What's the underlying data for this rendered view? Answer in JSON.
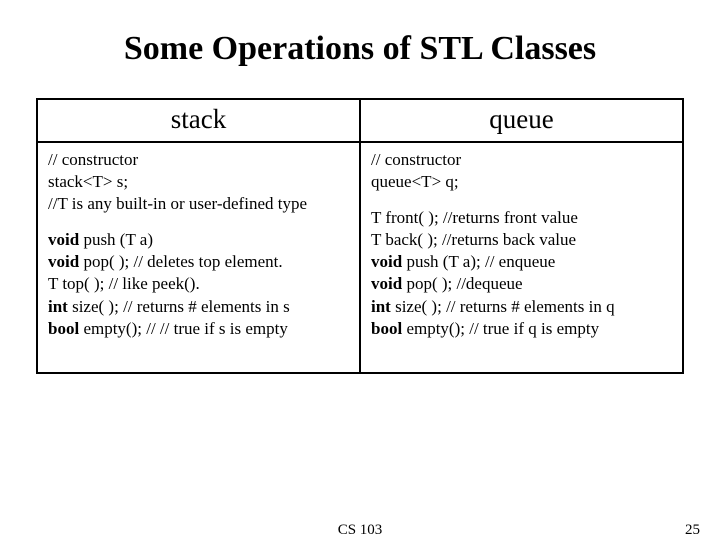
{
  "title": "Some Operations of STL Classes",
  "table": {
    "headers": {
      "left": "stack",
      "right": "queue"
    },
    "stack": {
      "l1": "// constructor",
      "l2": "stack<T> s;",
      "l3": "//T is any built-in or user-defined type",
      "p1a": "void",
      "p1b": " push (T a)",
      "p2a": "void",
      "p2b": " pop( ); // deletes top element.",
      "p3": "T top( );  // like peek().",
      "p4a": "int",
      "p4b": " size( ); // returns # elements in s",
      "p5a": "bool",
      "p5b": " empty(); // // true if s is empty"
    },
    "queue": {
      "l1": "// constructor",
      "l2": "queue<T> q;",
      "q1": "T front( ); //returns front value",
      "q2": "T back( ); //returns back value",
      "q3a": "void",
      "q3b": " push (T a);  // enqueue",
      "q4a": "void",
      "q4b": " pop( );        //dequeue",
      "q5a": "int",
      "q5b": " size( );  // returns # elements in q",
      "q6a": "bool",
      "q6b": " empty();    // true if q is empty"
    }
  },
  "footer": {
    "center": "CS 103",
    "page": "25"
  }
}
